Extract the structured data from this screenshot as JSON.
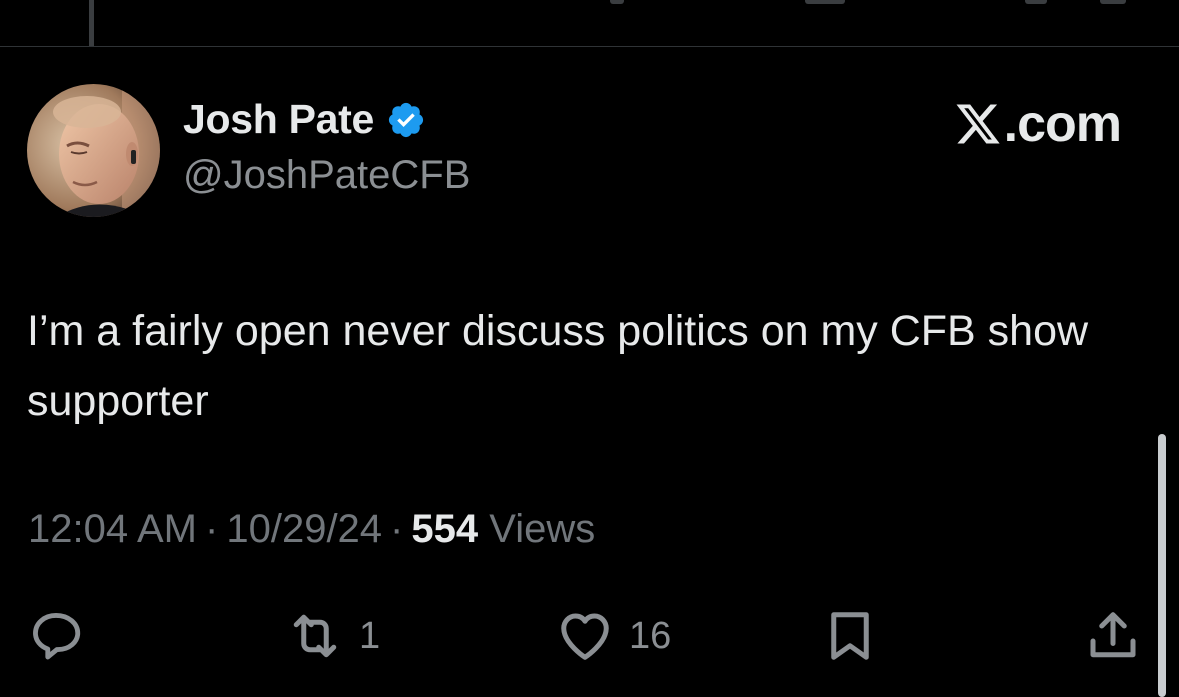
{
  "author": {
    "display_name": "Josh Pate",
    "handle": "@JoshPateCFB",
    "verified": true
  },
  "brand": {
    "text": ".com",
    "icon": "x-logo-icon"
  },
  "tweet": {
    "text": "I’m a fairly open never discuss politics on my CFB show supporter"
  },
  "meta": {
    "time": "12:04 AM",
    "date": "10/29/24",
    "views_count": "554",
    "views_label": "Views"
  },
  "actions": {
    "reply": {
      "icon": "reply-icon",
      "count": ""
    },
    "repost": {
      "icon": "repost-icon",
      "count": "1"
    },
    "like": {
      "icon": "heart-icon",
      "count": "16"
    },
    "bookmark": {
      "icon": "bookmark-icon",
      "count": ""
    },
    "share": {
      "icon": "share-icon",
      "count": ""
    }
  },
  "colors": {
    "background": "#000000",
    "text_primary": "#e7e9ea",
    "text_secondary": "#71767b",
    "verified_blue": "#1d9bf0"
  }
}
